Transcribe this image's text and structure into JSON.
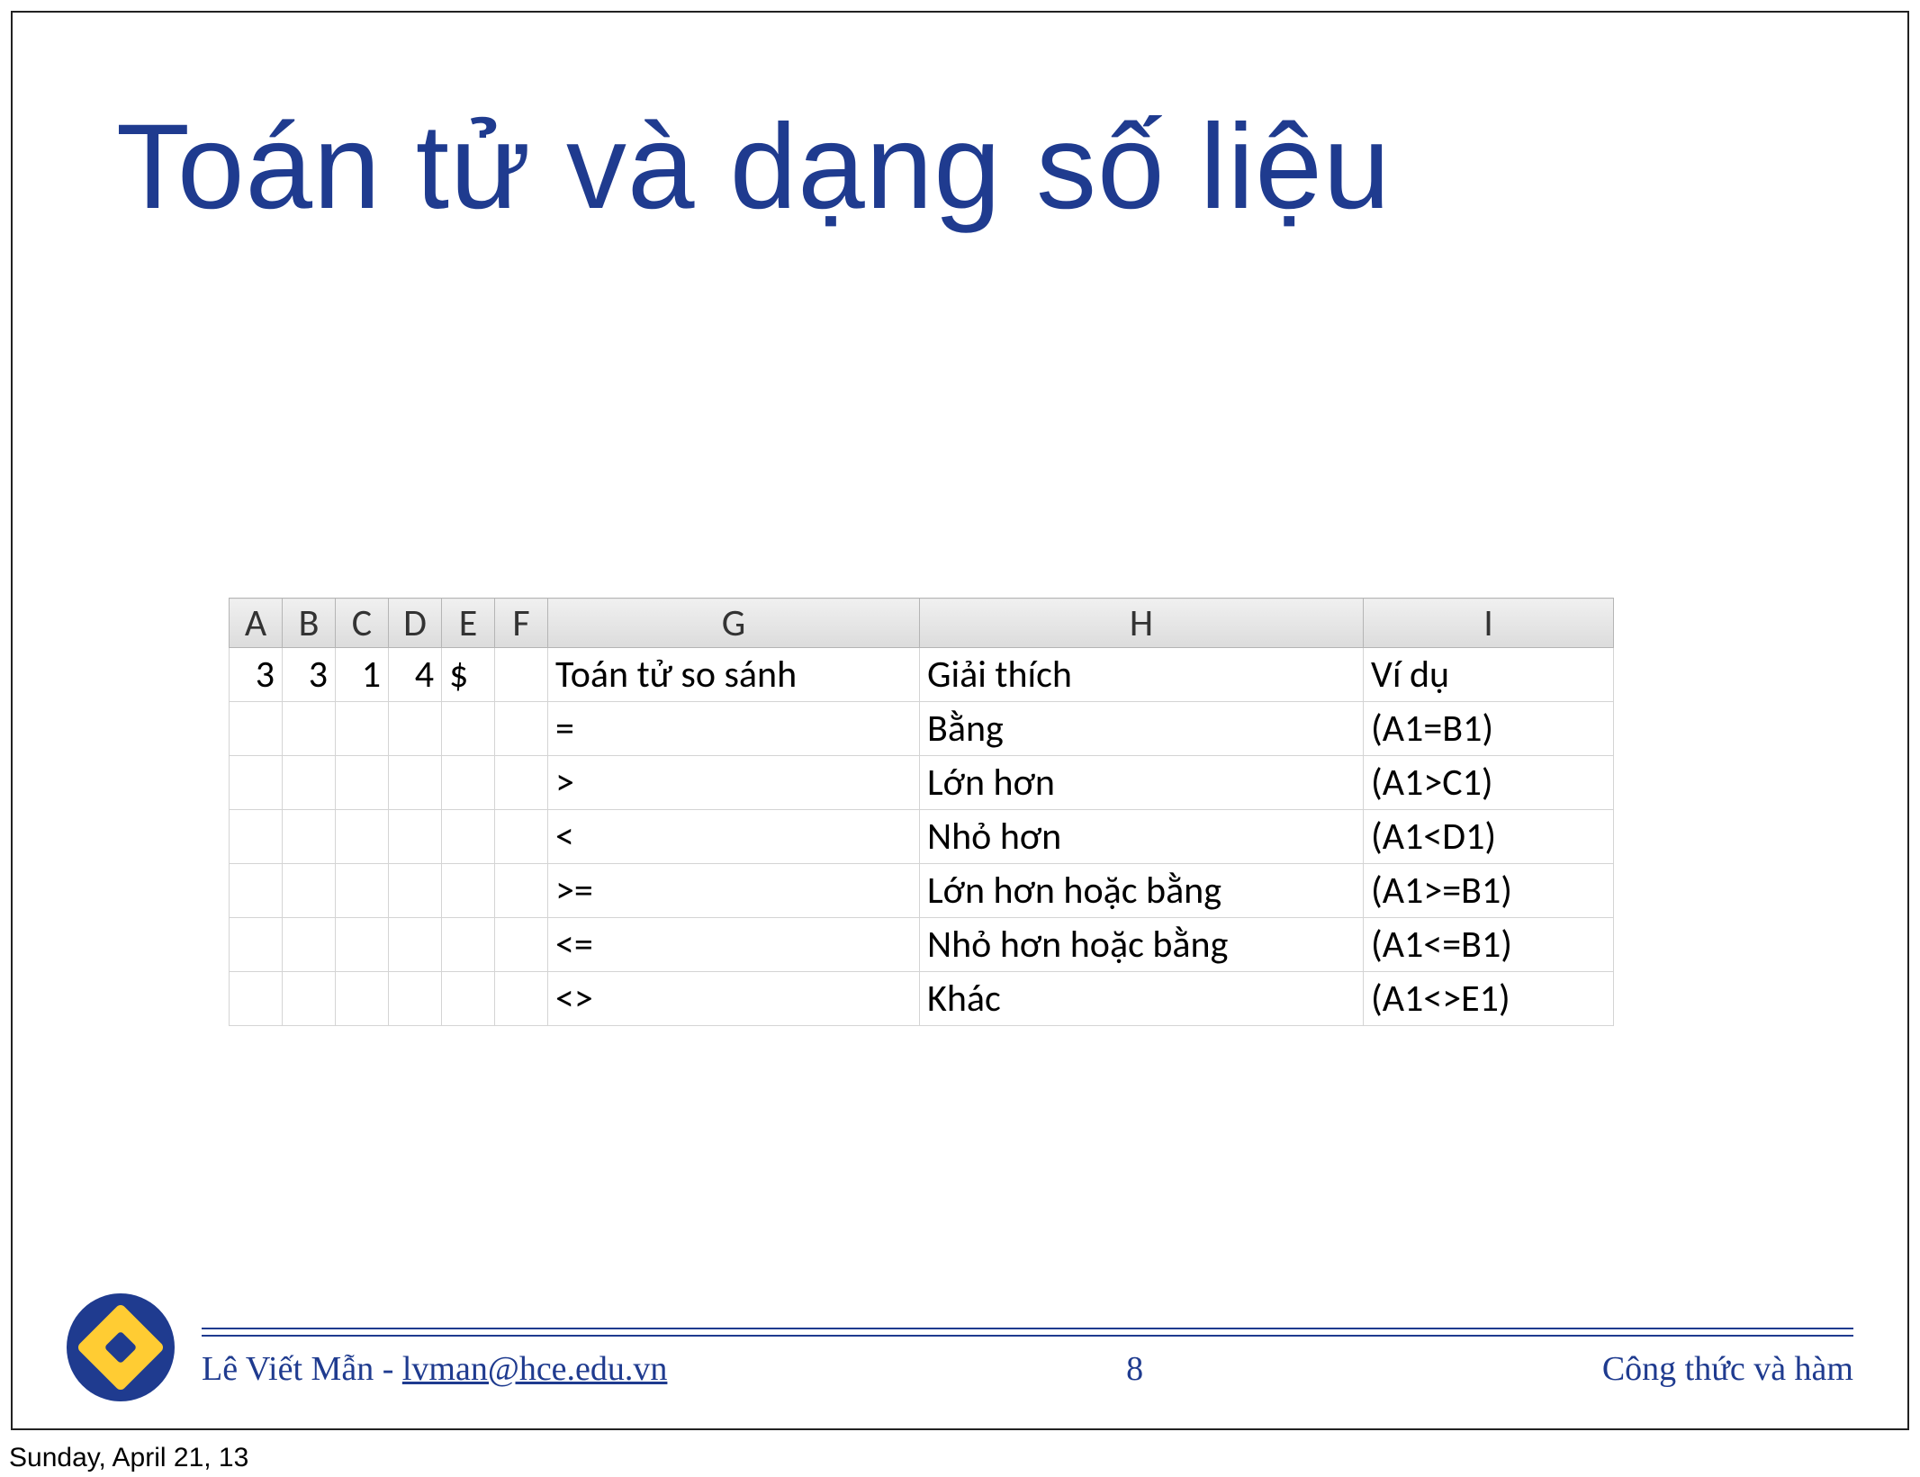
{
  "title": "Toán tử và dạng số liệu",
  "sheet": {
    "columns": [
      "A",
      "B",
      "C",
      "D",
      "E",
      "F",
      "G",
      "H",
      "I"
    ],
    "rows": [
      {
        "A": "3",
        "B": "3",
        "C": "1",
        "D": "4",
        "E": "$",
        "F": "",
        "G": "Toán tử so sánh",
        "H": "Giải thích",
        "I": "Ví dụ"
      },
      {
        "A": "",
        "B": "",
        "C": "",
        "D": "",
        "E": "",
        "F": "",
        "G": "=",
        "H": "Bằng",
        "I": "(A1=B1)"
      },
      {
        "A": "",
        "B": "",
        "C": "",
        "D": "",
        "E": "",
        "F": "",
        "G": ">",
        "H": "Lớn hơn",
        "I": "(A1>C1)"
      },
      {
        "A": "",
        "B": "",
        "C": "",
        "D": "",
        "E": "",
        "F": "",
        "G": "<",
        "H": "Nhỏ hơn",
        "I": "(A1<D1)"
      },
      {
        "A": "",
        "B": "",
        "C": "",
        "D": "",
        "E": "",
        "F": "",
        "G": ">=",
        "H": "Lớn hơn hoặc bằng",
        "I": "(A1>=B1)"
      },
      {
        "A": "",
        "B": "",
        "C": "",
        "D": "",
        "E": "",
        "F": "",
        "G": "<=",
        "H": "Nhỏ hơn hoặc bằng",
        "I": "(A1<=B1)"
      },
      {
        "A": "",
        "B": "",
        "C": "",
        "D": "",
        "E": "",
        "F": "",
        "G": "<>",
        "H": "Khác",
        "I": "(A1<>E1)"
      }
    ]
  },
  "footer": {
    "author": "Lê Viết Mẫn - ",
    "email": "lvman@hce.edu.vn",
    "page": "8",
    "topic": "Công thức và hàm"
  },
  "date": "Sunday, April 21, 13"
}
